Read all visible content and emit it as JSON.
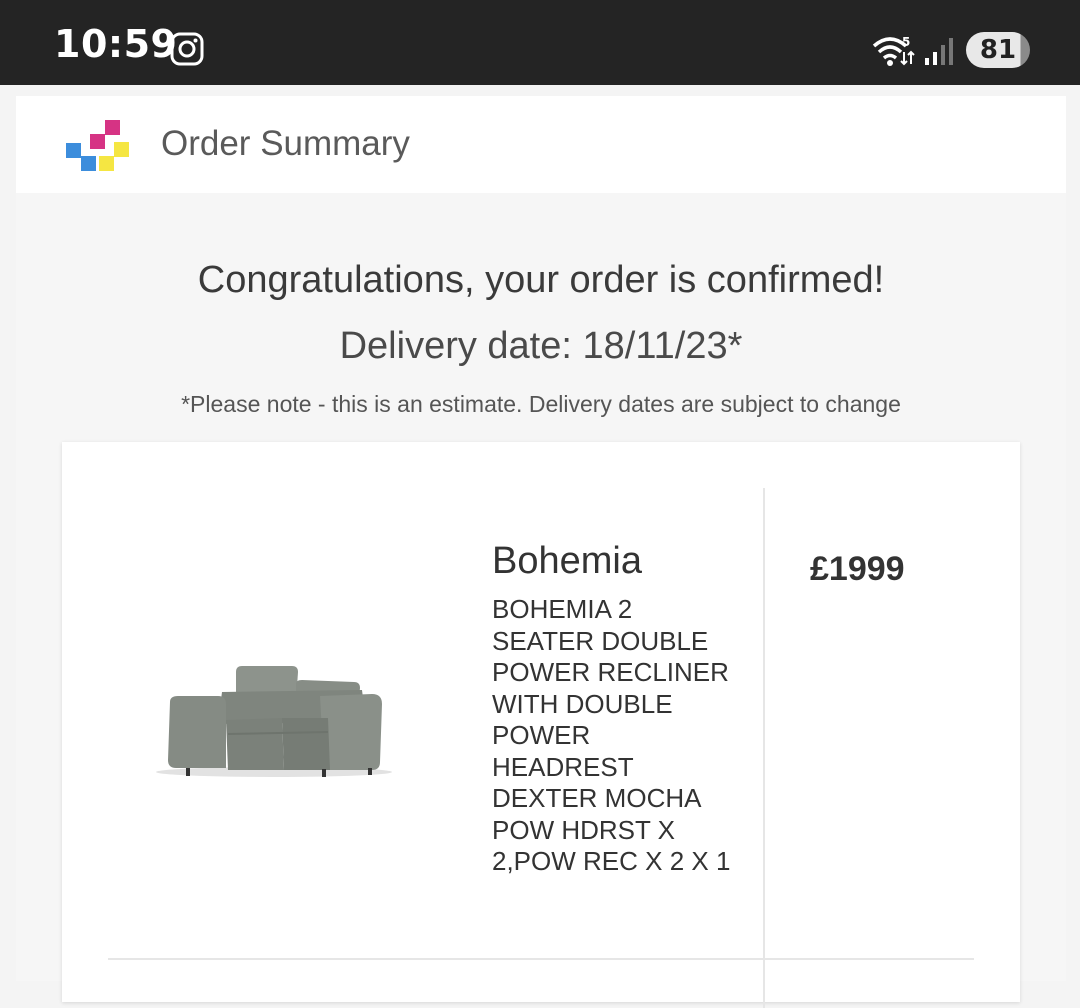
{
  "status_bar": {
    "time": "10:59",
    "battery": "81",
    "icons": [
      "instagram-icon",
      "wifi-icon",
      "signal-icon",
      "battery-icon"
    ]
  },
  "header": {
    "title": "Order Summary",
    "logo_colors": [
      "#d63384",
      "#3c8ddc",
      "#f5e642"
    ]
  },
  "confirmation": {
    "headline": "Congratulations, your order is confirmed!",
    "delivery": "Delivery date: 18/11/23*",
    "note": "*Please note - this is an estimate. Delivery dates are subject to change"
  },
  "order_item": {
    "name": "Bohemia",
    "description": "BOHEMIA 2 SEATER DOUBLE POWER RECLINER WITH DOUBLE POWER HEADREST DEXTER MOCHA POW HDRST X 2,POW REC X 2 X 1",
    "price": "£1999"
  }
}
